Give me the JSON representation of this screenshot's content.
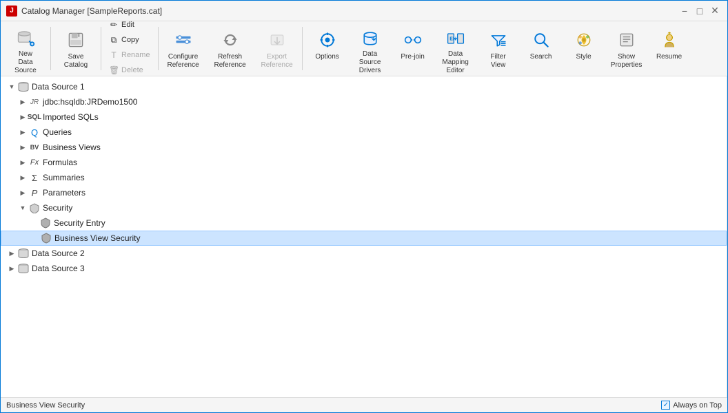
{
  "window": {
    "title": "Catalog Manager [SampleReports.cat]",
    "close_btn": "✕"
  },
  "toolbar": {
    "groups": [
      {
        "id": "new",
        "buttons": [
          {
            "id": "new-data-source",
            "label": "New\nData Source",
            "icon": "new-ds",
            "disabled": false
          }
        ]
      },
      {
        "id": "file",
        "buttons": [
          {
            "id": "save-catalog",
            "label": "Save\nCatalog",
            "icon": "save",
            "disabled": false
          }
        ]
      },
      {
        "id": "edit-group",
        "mini": true,
        "items": [
          {
            "id": "edit",
            "label": "Edit",
            "icon": "edit",
            "disabled": false
          },
          {
            "id": "copy",
            "label": "Copy",
            "icon": "copy",
            "disabled": false
          },
          {
            "id": "rename",
            "label": "Rename",
            "icon": "rename",
            "disabled": false
          },
          {
            "id": "delete",
            "label": "Delete",
            "icon": "delete",
            "disabled": false
          }
        ]
      },
      {
        "id": "configure",
        "buttons": [
          {
            "id": "configure-reference",
            "label": "Configure\nReference",
            "icon": "configure",
            "disabled": false
          }
        ]
      },
      {
        "id": "refresh",
        "buttons": [
          {
            "id": "refresh-reference",
            "label": "Refresh\nReference",
            "icon": "refresh",
            "disabled": false
          }
        ]
      },
      {
        "id": "export",
        "buttons": [
          {
            "id": "export-reference",
            "label": "Export\nReference",
            "icon": "export",
            "disabled": true
          }
        ]
      },
      {
        "id": "options-group",
        "buttons": [
          {
            "id": "options",
            "label": "Options",
            "icon": "options",
            "disabled": false
          },
          {
            "id": "data-source-drivers",
            "label": "Data Source\nDrivers",
            "icon": "ds-drivers",
            "disabled": false
          },
          {
            "id": "pre-join",
            "label": "Pre-join",
            "icon": "prejoin",
            "disabled": false
          },
          {
            "id": "data-mapping-editor",
            "label": "Data Mapping\nEditor",
            "icon": "dme",
            "disabled": false
          },
          {
            "id": "filter-view",
            "label": "Filter\nView",
            "icon": "filter",
            "disabled": false
          },
          {
            "id": "search",
            "label": "Search",
            "icon": "search",
            "disabled": false
          },
          {
            "id": "style",
            "label": "Style",
            "icon": "style",
            "disabled": false
          },
          {
            "id": "show-properties",
            "label": "Show\nProperties",
            "icon": "properties",
            "disabled": false
          },
          {
            "id": "resume",
            "label": "Resume",
            "icon": "resume",
            "disabled": false
          }
        ]
      }
    ]
  },
  "tree": {
    "items": [
      {
        "id": "ds1",
        "label": "Data Source 1",
        "level": 1,
        "icon": "datasource",
        "expanded": true,
        "toggle": "▼"
      },
      {
        "id": "ds1-jdbc",
        "label": "jdbc:hsqldb:JRDemo1500",
        "level": 2,
        "icon": "jdbc",
        "expanded": false,
        "toggle": "▶"
      },
      {
        "id": "ds1-sql",
        "label": "Imported SQLs",
        "level": 2,
        "icon": "sql",
        "expanded": false,
        "toggle": "▶"
      },
      {
        "id": "ds1-queries",
        "label": "Queries",
        "level": 2,
        "icon": "query",
        "expanded": false,
        "toggle": "▶"
      },
      {
        "id": "ds1-bv",
        "label": "Business Views",
        "level": 2,
        "icon": "bv",
        "expanded": false,
        "toggle": "▶"
      },
      {
        "id": "ds1-formulas",
        "label": "Formulas",
        "level": 2,
        "icon": "fx",
        "expanded": false,
        "toggle": "▶"
      },
      {
        "id": "ds1-summaries",
        "label": "Summaries",
        "level": 2,
        "icon": "sigma",
        "expanded": false,
        "toggle": "▶"
      },
      {
        "id": "ds1-params",
        "label": "Parameters",
        "level": 2,
        "icon": "param",
        "expanded": false,
        "toggle": "▶"
      },
      {
        "id": "ds1-security",
        "label": "Security",
        "level": 2,
        "icon": "security",
        "expanded": true,
        "toggle": "▼"
      },
      {
        "id": "ds1-security-entry",
        "label": "Security Entry",
        "level": 3,
        "icon": "security-leaf",
        "expanded": false,
        "toggle": ""
      },
      {
        "id": "ds1-security-bv",
        "label": "Business View Security",
        "level": 3,
        "icon": "security-leaf",
        "expanded": false,
        "toggle": "",
        "selected": true
      },
      {
        "id": "ds2",
        "label": "Data Source 2",
        "level": 1,
        "icon": "datasource",
        "expanded": false,
        "toggle": "▶"
      },
      {
        "id": "ds3",
        "label": "Data Source 3",
        "level": 1,
        "icon": "datasource",
        "expanded": false,
        "toggle": "▶"
      }
    ]
  },
  "status": {
    "text": "Business View Security",
    "always_on_top": "Always on Top"
  }
}
